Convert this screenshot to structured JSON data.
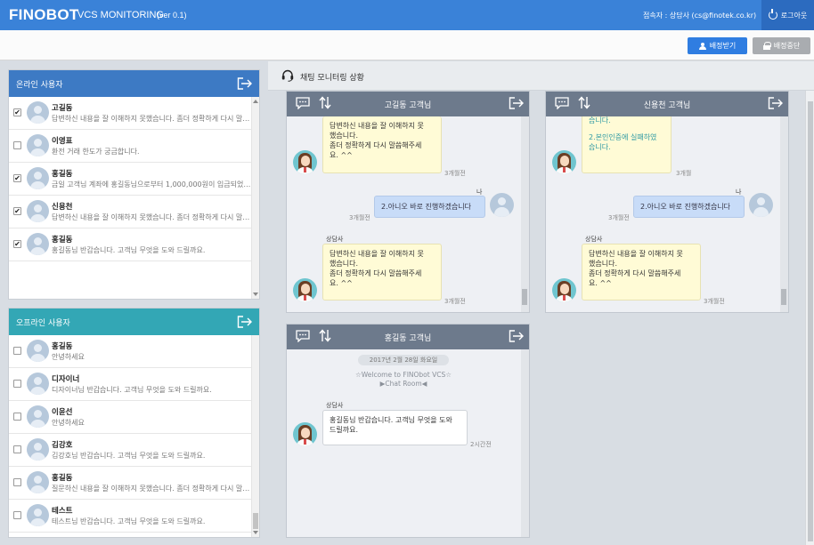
{
  "header": {
    "brand": "FINOBOT",
    "subtitle": "VCS MONITORING",
    "version": "(ver 0.1)",
    "user_info": "접속자 : 상담사 (cs@finotek.co.kr)",
    "logout_label": "로그아웃",
    "colors": {
      "bar": "#3a82d8",
      "logout": "#2c6bbf"
    }
  },
  "toolbar": {
    "assign_label": "배정받기",
    "stop_label": "배정중단"
  },
  "online_panel": {
    "title": "온라인 사용자",
    "users": [
      {
        "name": "고길동",
        "message": "답변하신 내용을 잘 이해하지 못했습니다. 좀더 정확하게 다시 말씀해주세요.",
        "checked": true
      },
      {
        "name": "이영표",
        "message": "환전 거래 한도가 궁금합니다.",
        "checked": false
      },
      {
        "name": "홍길동",
        "message": "금일 고객님 계좌에 홍길동님으로부터 1,000,000원이 입금되었습니다.",
        "checked": true
      },
      {
        "name": "신용천",
        "message": "답변하신 내용을 잘 이해하지 못했습니다. 좀더 정확하게 다시 말씀해주세요.",
        "checked": true
      },
      {
        "name": "홍길동",
        "message": "홍길동님 반갑습니다. 고객님 무엇을 도와 드릴까요.",
        "checked": true
      }
    ]
  },
  "offline_panel": {
    "title": "오프라인 사용자",
    "users": [
      {
        "name": "홍길동",
        "message": "안녕하세요",
        "checked": false
      },
      {
        "name": "디자이너",
        "message": "디자이너님 반갑습니다. 고객님 무엇을 도와 드릴까요.",
        "checked": false
      },
      {
        "name": "이윤선",
        "message": "안녕하세요",
        "checked": false
      },
      {
        "name": "김강호",
        "message": "김강호님 반갑습니다. 고객님 무엇을 도와 드릴까요.",
        "checked": false
      },
      {
        "name": "홍길동",
        "message": "질문하신 내용을 잘 이해하지 못했습니다. 좀더 정확하게 다시 말씀해주세요.",
        "checked": false
      },
      {
        "name": "테스트",
        "message": "테스트님 반갑습니다. 고객님 무엇을 도와 드릴까요.",
        "checked": false
      }
    ]
  },
  "monitor": {
    "title": "채팅 모니터링 상황"
  },
  "chat1": {
    "title": "고길동 고객님",
    "bubble1": [
      "답변하신 내용을 잘 이해하지 못",
      "했습니다.",
      "좀더 정확하게 다시 말씀해주세",
      "요. ^^"
    ],
    "bubble1_time": "3개월전",
    "me_label": "나",
    "me_text": "2.아니오 바로 진행하겠습니다",
    "me_time": "3개월전",
    "agent_label": "상담사",
    "bubble2": [
      "답변하신 내용을 잘 이해하지 못",
      "했습니다.",
      "좀더 정확하게 다시 말씀해주세",
      "요. ^^"
    ],
    "bubble2_time": "3개월전"
  },
  "chat2": {
    "title": "신용천 고객님",
    "bubble1_top": "습니다.",
    "bubble1": [
      "2.본인인증에 실패하였",
      "습니다."
    ],
    "bubble1_time": "3개월",
    "me_label": "나",
    "me_text": "2.아니오 바로 진행하겠습니다",
    "me_time": "3개월전",
    "agent_label": "상담사",
    "bubble2": [
      "답변하신 내용을 잘 이해하지 못",
      "했습니다.",
      "좀더 정확하게 다시 말씀해주세",
      "요. ^^"
    ],
    "bubble2_time": "3개월전"
  },
  "chat3": {
    "title": "홍길동 고객님",
    "date": "2017년 2월 28일 화요일",
    "welcome1": "☆Welcome to FINObot VCS☆",
    "welcome2": "▶Chat Room◀",
    "agent_label": "상담사",
    "bubble": [
      "홍길동님 반갑습니다. 고객님 무엇을 도와",
      "드릴까요."
    ],
    "bubble_time": "2시간전"
  }
}
